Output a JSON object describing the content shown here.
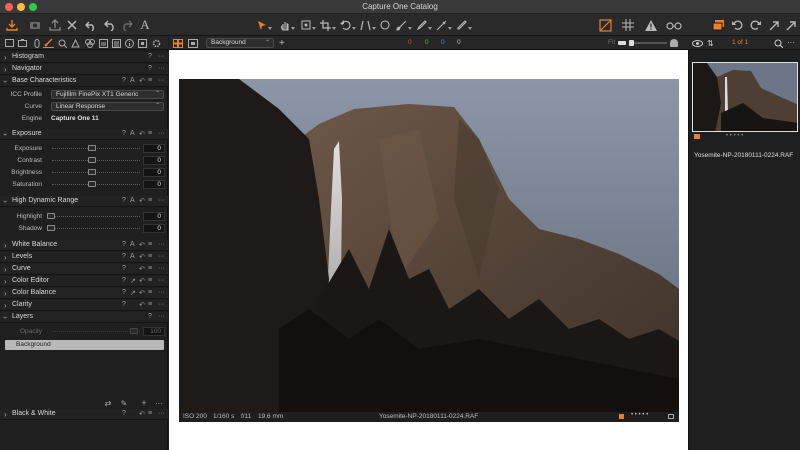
{
  "window": {
    "title": "Capture One Catalog"
  },
  "viewer_toolbar": {
    "variant_select": "Background",
    "wb_values": [
      "0",
      "0",
      "0",
      "0"
    ],
    "wb_colors": [
      "#e04a3a",
      "#39c450",
      "#5a7bff",
      "#bdbdbd"
    ],
    "fit_label": "Fit",
    "page_count": "1 of 1"
  },
  "tools": {
    "histogram": "Histogram",
    "navigator": "Navigator",
    "base_characteristics": {
      "title": "Base Characteristics",
      "icc_profile_label": "ICC Profile",
      "icc_profile_value": "Fujifilm FinePix XT1 Generic",
      "curve_label": "Curve",
      "curve_value": "Linear Response",
      "engine_label": "Engine",
      "engine_value": "Capture One 11"
    },
    "exposure": {
      "title": "Exposure",
      "rows": [
        {
          "label": "Exposure",
          "value": "0"
        },
        {
          "label": "Contrast",
          "value": "0"
        },
        {
          "label": "Brightness",
          "value": "0"
        },
        {
          "label": "Saturation",
          "value": "0"
        }
      ]
    },
    "hdr": {
      "title": "High Dynamic Range",
      "rows": [
        {
          "label": "Highlight",
          "value": "0"
        },
        {
          "label": "Shadow",
          "value": "0"
        }
      ]
    },
    "collapsed": [
      "White Balance",
      "Levels",
      "Curve",
      "Color Editor",
      "Color Balance",
      "Clarity"
    ],
    "layers": {
      "title": "Layers",
      "opacity_label": "Opacity",
      "opacity_value": "100",
      "layer_name": "Background"
    },
    "black_white": "Black & White"
  },
  "image": {
    "iso": "ISO 200",
    "shutter": "1/160 s",
    "aperture": "f/11",
    "focal": "19.6 mm",
    "filename": "Yosemite-NP-20180111-0224.RAF"
  },
  "browser": {
    "thumb_filename": "Yosemite-NP-20180111-0224.RAF"
  }
}
